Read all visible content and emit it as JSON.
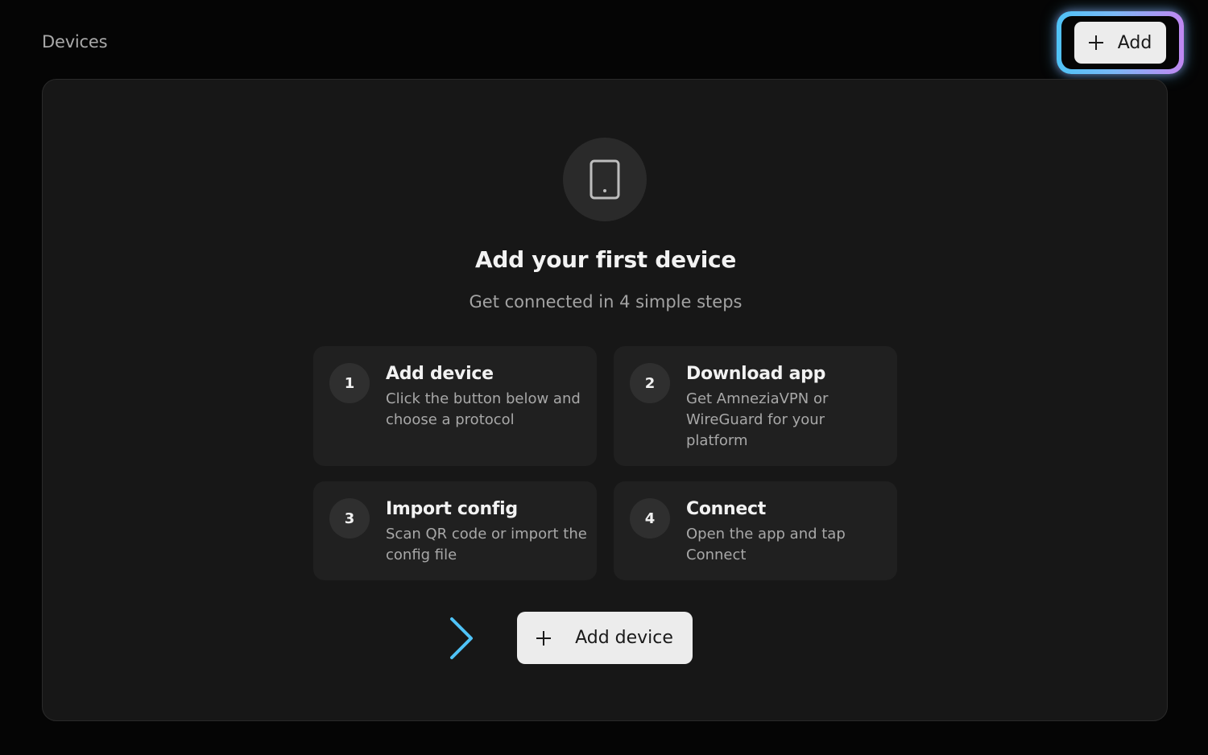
{
  "header": {
    "title": "Devices",
    "add_label": "Add",
    "add_icon": "plus-icon"
  },
  "empty_state": {
    "icon": "tablet-icon",
    "title": "Add your first device",
    "subtitle": "Get connected in 4 simple steps",
    "steps": [
      {
        "number": "1",
        "title": "Add device",
        "description": "Click the button below and choose a protocol"
      },
      {
        "number": "2",
        "title": "Download app",
        "description": "Get AmneziaVPN or WireGuard for your platform"
      },
      {
        "number": "3",
        "title": "Import config",
        "description": "Scan QR code or import the config file"
      },
      {
        "number": "4",
        "title": "Connect",
        "description": "Open the app and tap Connect"
      }
    ],
    "cta_label": "Add device",
    "cta_icon": "plus-icon",
    "pointer_icon": "arrow-right-icon"
  },
  "colors": {
    "background": "#050505",
    "panel": "#171717",
    "card": "#202020",
    "button": "#ececec",
    "glow_start": "#4fc3f7",
    "glow_end": "#c087f2"
  }
}
